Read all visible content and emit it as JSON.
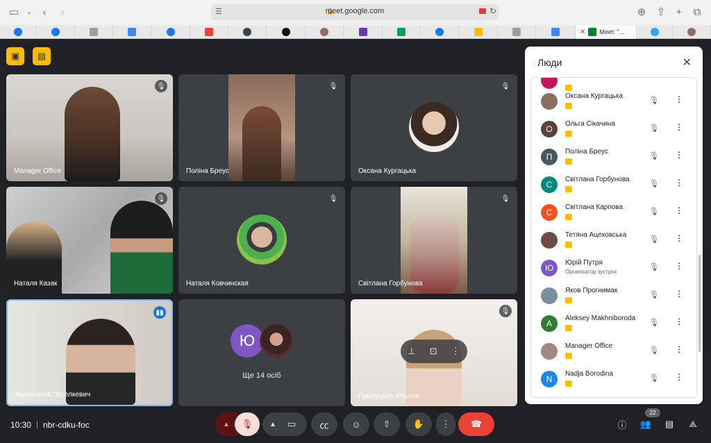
{
  "browser": {
    "url": "meet.google.com",
    "active_tab_title": "Meet: \"..."
  },
  "tiles": [
    {
      "name": "Manager Office"
    },
    {
      "name": "Поліна Бреус"
    },
    {
      "name": "Оксана Кургацька"
    },
    {
      "name": "Наталя Казак"
    },
    {
      "name": "Наталя Ковчинская"
    },
    {
      "name": "Світлана Горбунова"
    },
    {
      "name": "Валентина Поселкевич"
    },
    {
      "name": "Ще 14 осіб",
      "avatar_letter": "Ю"
    },
    {
      "name": "Прилуцька Альона"
    }
  ],
  "people_panel": {
    "title": "Люди",
    "people": [
      {
        "name": "Оксана Кургацька",
        "letter": "",
        "color": "#8d6e63"
      },
      {
        "name": "Ольга Сікачина",
        "letter": "О",
        "color": "#5d4037"
      },
      {
        "name": "Поліна Бреус",
        "letter": "П",
        "color": "#455a64"
      },
      {
        "name": "Світлана Горбунова",
        "letter": "С",
        "color": "#00897b"
      },
      {
        "name": "Світлана Карпова",
        "letter": "С",
        "color": "#f4511e"
      },
      {
        "name": "Тетяна Ацеховська",
        "letter": "",
        "color": "#6d4c41"
      },
      {
        "name": "Юрій Путря",
        "letter": "Ю",
        "color": "#7e57c2",
        "subtitle": "Організатор зустрічі"
      },
      {
        "name": "Яков Прогнимак",
        "letter": "",
        "color": "#78909c"
      },
      {
        "name": "Aleksey Makhniboroda",
        "letter": "A",
        "color": "#2e7d32"
      },
      {
        "name": "Manager Office",
        "letter": "",
        "color": "#a1887f"
      },
      {
        "name": "Nadja Borodina",
        "letter": "N",
        "color": "#1e88e5"
      }
    ]
  },
  "bottom_bar": {
    "time": "10:30",
    "separator": "|",
    "meeting_code": "nbr-cdku-foc",
    "participant_count": "22"
  }
}
